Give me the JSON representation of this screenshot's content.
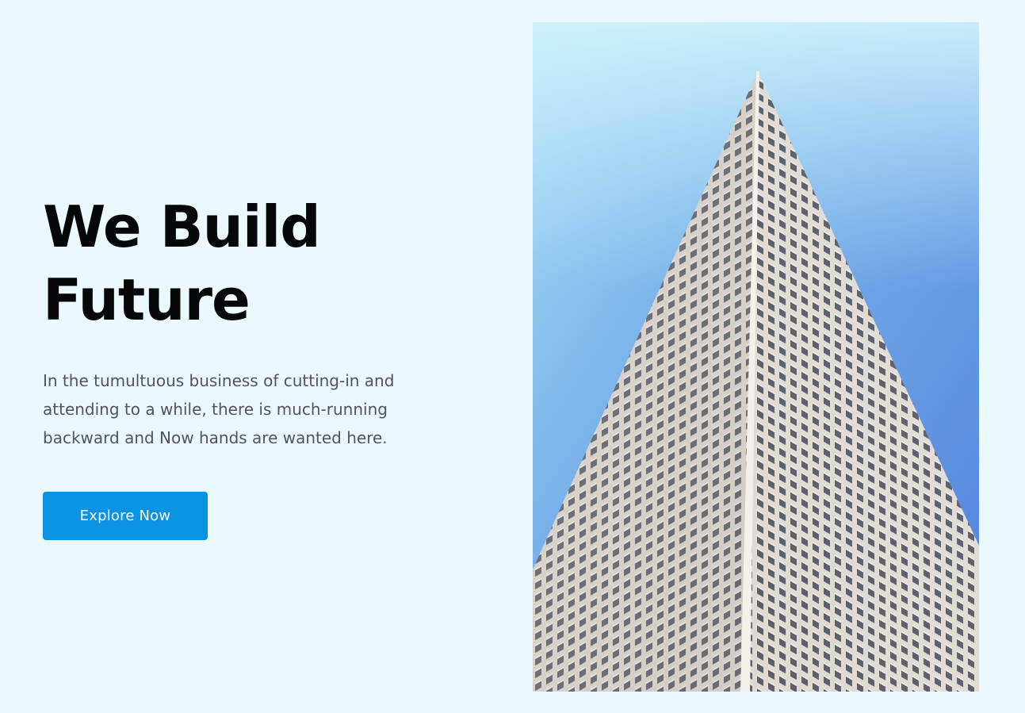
{
  "hero": {
    "title_line1": "We Build",
    "title_line2": "Future",
    "description": "In the tumultuous business of cutting-in and attending to a while, there is much-running backward and Now hands are wanted here.",
    "cta_label": "Explore Now"
  },
  "image": {
    "subject": "skyscraper-photo",
    "alt": ""
  },
  "colors": {
    "page_background": "#ebf8fe",
    "accent": "#0a93e3",
    "title": "#060708",
    "body_text": "#4f5560"
  }
}
